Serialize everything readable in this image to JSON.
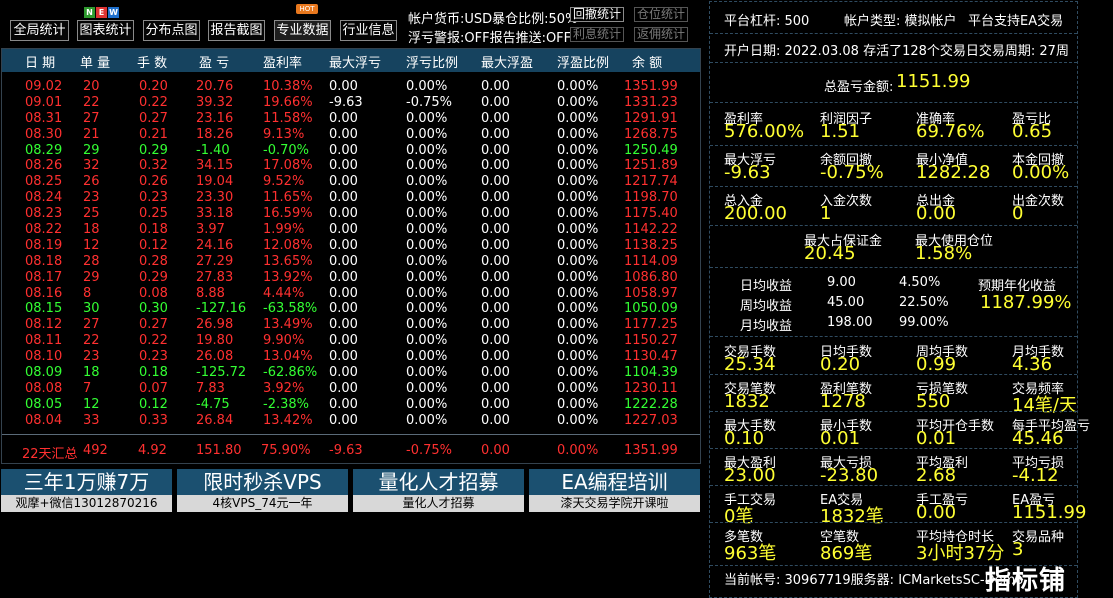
{
  "toolbar": {
    "buttons": [
      "全局统计",
      "图表统计",
      "分布点图",
      "报告截图",
      "专业数据",
      "行业信息"
    ],
    "new_badge": [
      "N",
      "E",
      "W"
    ],
    "hot_badge": "HOT",
    "account_currency": "帐户货币:USD暴仓比例:50%",
    "floating_alert": "浮亏警报:OFF报告推送:OFF",
    "small_buttons": [
      "回撤统计",
      "仓位统计",
      "利息统计",
      "返佣统计"
    ]
  },
  "table": {
    "headers": [
      "日 期",
      "单 量",
      "手 数",
      "盈 亏",
      "盈利率",
      "最大浮亏",
      "浮亏比例",
      "最大浮盈",
      "浮盈比例",
      "余 额"
    ],
    "rows": [
      {
        "c": "red",
        "cells": [
          "09.02",
          "20",
          "0.20",
          "20.76",
          "10.38%",
          "0.00",
          "0.00%",
          "0.00",
          "0.00%",
          "1351.99"
        ]
      },
      {
        "c": "red",
        "cells": [
          "09.01",
          "22",
          "0.22",
          "39.32",
          "19.66%",
          "-9.63",
          "-0.75%",
          "0.00",
          "0.00%",
          "1331.23"
        ]
      },
      {
        "c": "red",
        "cells": [
          "08.31",
          "27",
          "0.27",
          "23.16",
          "11.58%",
          "0.00",
          "0.00%",
          "0.00",
          "0.00%",
          "1291.91"
        ]
      },
      {
        "c": "red",
        "cells": [
          "08.30",
          "21",
          "0.21",
          "18.26",
          "9.13%",
          "0.00",
          "0.00%",
          "0.00",
          "0.00%",
          "1268.75"
        ]
      },
      {
        "c": "green",
        "cells": [
          "08.29",
          "29",
          "0.29",
          "-1.40",
          "-0.70%",
          "0.00",
          "0.00%",
          "0.00",
          "0.00%",
          "1250.49"
        ]
      },
      {
        "c": "red",
        "cells": [
          "08.26",
          "32",
          "0.32",
          "34.15",
          "17.08%",
          "0.00",
          "0.00%",
          "0.00",
          "0.00%",
          "1251.89"
        ]
      },
      {
        "c": "red",
        "cells": [
          "08.25",
          "26",
          "0.26",
          "19.04",
          "9.52%",
          "0.00",
          "0.00%",
          "0.00",
          "0.00%",
          "1217.74"
        ]
      },
      {
        "c": "red",
        "cells": [
          "08.24",
          "23",
          "0.23",
          "23.30",
          "11.65%",
          "0.00",
          "0.00%",
          "0.00",
          "0.00%",
          "1198.70"
        ]
      },
      {
        "c": "red",
        "cells": [
          "08.23",
          "25",
          "0.25",
          "33.18",
          "16.59%",
          "0.00",
          "0.00%",
          "0.00",
          "0.00%",
          "1175.40"
        ]
      },
      {
        "c": "red",
        "cells": [
          "08.22",
          "18",
          "0.18",
          "3.97",
          "1.99%",
          "0.00",
          "0.00%",
          "0.00",
          "0.00%",
          "1142.22"
        ]
      },
      {
        "c": "red",
        "cells": [
          "08.19",
          "12",
          "0.12",
          "24.16",
          "12.08%",
          "0.00",
          "0.00%",
          "0.00",
          "0.00%",
          "1138.25"
        ]
      },
      {
        "c": "red",
        "cells": [
          "08.18",
          "28",
          "0.28",
          "27.29",
          "13.65%",
          "0.00",
          "0.00%",
          "0.00",
          "0.00%",
          "1114.09"
        ]
      },
      {
        "c": "red",
        "cells": [
          "08.17",
          "29",
          "0.29",
          "27.83",
          "13.92%",
          "0.00",
          "0.00%",
          "0.00",
          "0.00%",
          "1086.80"
        ]
      },
      {
        "c": "red",
        "cells": [
          "08.16",
          "8",
          "0.08",
          "8.88",
          "4.44%",
          "0.00",
          "0.00%",
          "0.00",
          "0.00%",
          "1058.97"
        ]
      },
      {
        "c": "green",
        "cells": [
          "08.15",
          "30",
          "0.30",
          "-127.16",
          "-63.58%",
          "0.00",
          "0.00%",
          "0.00",
          "0.00%",
          "1050.09"
        ]
      },
      {
        "c": "red",
        "cells": [
          "08.12",
          "27",
          "0.27",
          "26.98",
          "13.49%",
          "0.00",
          "0.00%",
          "0.00",
          "0.00%",
          "1177.25"
        ]
      },
      {
        "c": "red",
        "cells": [
          "08.11",
          "22",
          "0.22",
          "19.80",
          "9.90%",
          "0.00",
          "0.00%",
          "0.00",
          "0.00%",
          "1150.27"
        ]
      },
      {
        "c": "red",
        "cells": [
          "08.10",
          "23",
          "0.23",
          "26.08",
          "13.04%",
          "0.00",
          "0.00%",
          "0.00",
          "0.00%",
          "1130.47"
        ]
      },
      {
        "c": "green",
        "cells": [
          "08.09",
          "18",
          "0.18",
          "-125.72",
          "-62.86%",
          "0.00",
          "0.00%",
          "0.00",
          "0.00%",
          "1104.39"
        ]
      },
      {
        "c": "red",
        "cells": [
          "08.08",
          "7",
          "0.07",
          "7.83",
          "3.92%",
          "0.00",
          "0.00%",
          "0.00",
          "0.00%",
          "1230.11"
        ]
      },
      {
        "c": "green",
        "cells": [
          "08.05",
          "12",
          "0.12",
          "-4.75",
          "-2.38%",
          "0.00",
          "0.00%",
          "0.00",
          "0.00%",
          "1222.28"
        ]
      },
      {
        "c": "red",
        "cells": [
          "08.04",
          "33",
          "0.33",
          "26.84",
          "13.42%",
          "0.00",
          "0.00%",
          "0.00",
          "0.00%",
          "1227.03"
        ]
      }
    ],
    "summary": [
      "22天汇总",
      "492",
      "4.92",
      "151.80",
      "75.90%",
      "-9.63",
      "-0.75%",
      "0.00",
      "0.00%",
      "1351.99"
    ]
  },
  "banners": [
    {
      "title": "三年1万赚7万",
      "sub": "观摩+微信13012870216"
    },
    {
      "title": "限时秒杀VPS",
      "sub": "4核VPS_74元一年"
    },
    {
      "title": "量化人才招募",
      "sub": "量化人才招募"
    },
    {
      "title": "EA编程培训",
      "sub": "漆天交易学院开课啦"
    }
  ],
  "panel": {
    "top": {
      "leverage": "平台杠杆:   500",
      "account_type": "帐户类型:   模拟帐户",
      "ea_support": "平台支持EA交易",
      "open_info": "开户日期:  2022.03.08  存活了128个交易日交易周期:  27周"
    },
    "total_label": "总盈亏金额:",
    "total_value": "1151.99",
    "stats1": [
      {
        "label": "盈利率",
        "value": "576.00%"
      },
      {
        "label": "利润因子",
        "value": "1.51"
      },
      {
        "label": "准确率",
        "value": "69.76%"
      },
      {
        "label": "盈亏比",
        "value": "0.65"
      },
      {
        "label": "最大浮亏",
        "value": "-9.63"
      },
      {
        "label": "余额回撤",
        "value": "-0.75%"
      },
      {
        "label": "最小净值",
        "value": "1282.28"
      },
      {
        "label": "本金回撤",
        "value": "0.00%"
      },
      {
        "label": "总入金",
        "value": "200.00"
      },
      {
        "label": "入金次数",
        "value": "1"
      },
      {
        "label": "总出金",
        "value": "0.00"
      },
      {
        "label": "出金次数",
        "value": "0"
      }
    ],
    "margin": [
      {
        "label": "最大占保证金",
        "value": "20.45"
      },
      {
        "label": "最大使用仓位",
        "value": "1.58%"
      }
    ],
    "returns": [
      {
        "label": "日均收益",
        "amount": "9.00",
        "pct": "4.50%"
      },
      {
        "label": "周均收益",
        "amount": "45.00",
        "pct": "22.50%"
      },
      {
        "label": "月均收益",
        "amount": "198.00",
        "pct": "99.00%"
      }
    ],
    "annual_label": "预期年化收益",
    "annual_value": "1187.99%",
    "stats2": [
      {
        "label": "交易手数",
        "value": "25.34"
      },
      {
        "label": "日均手数",
        "value": "0.20"
      },
      {
        "label": "周均手数",
        "value": "0.99"
      },
      {
        "label": "月均手数",
        "value": "4.36"
      },
      {
        "label": "交易笔数",
        "value": "1832"
      },
      {
        "label": "盈利笔数",
        "value": "1278"
      },
      {
        "label": "亏损笔数",
        "value": "550"
      },
      {
        "label": "交易频率",
        "value": "14笔/天"
      },
      {
        "label": "最大手数",
        "value": "0.10"
      },
      {
        "label": "最小手数",
        "value": "0.01"
      },
      {
        "label": "平均开仓手数",
        "value": "0.01"
      },
      {
        "label": "每手平均盈亏",
        "value": "45.46"
      },
      {
        "label": "最大盈利",
        "value": "23.00"
      },
      {
        "label": "最大亏损",
        "value": "-23.80"
      },
      {
        "label": "平均盈利",
        "value": "2.68"
      },
      {
        "label": "平均亏损",
        "value": "-4.12"
      },
      {
        "label": "手工交易",
        "value": "0笔"
      },
      {
        "label": "EA交易",
        "value": "1832笔"
      },
      {
        "label": "手工盈亏",
        "value": "0.00"
      },
      {
        "label": "EA盈亏",
        "value": "1151.99"
      },
      {
        "label": "多笔数",
        "value": "963笔"
      },
      {
        "label": "空笔数",
        "value": "869笔"
      },
      {
        "label": "平均持仓时长",
        "value": "3小时37分"
      },
      {
        "label": "交易品种",
        "value": "3"
      }
    ],
    "footer": "当前帐号:  30967719服务器:  ICMarketsSC-Demo"
  },
  "watermark": "指标铺",
  "colors": {
    "header_bg": "#16435f",
    "banner_bg": "#1b5070",
    "profit": "#ff3030",
    "loss": "#33ff33",
    "value": "#ffff33"
  }
}
